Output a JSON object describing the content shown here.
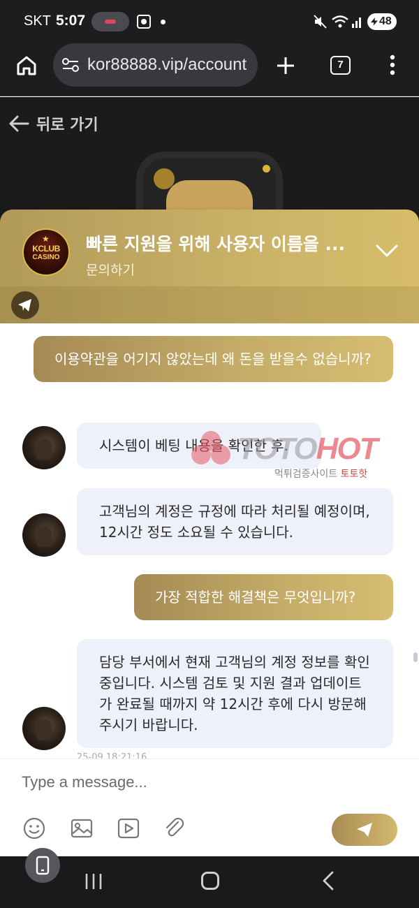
{
  "status_bar": {
    "carrier": "SKT",
    "time": "5:07",
    "battery": "48",
    "icons": [
      "screen-record-icon",
      "dot-icon",
      "mute-icon",
      "wifi-icon",
      "signal-icon",
      "battery-icon"
    ]
  },
  "browser": {
    "url": "kor88888.vip/account",
    "tab_count": "7",
    "icons": [
      "home-icon",
      "site-settings-icon",
      "plus-icon",
      "tabs-icon",
      "more-icon"
    ]
  },
  "page": {
    "back_label": "뒤로 가기"
  },
  "chat": {
    "title": "빠른 지원을 위해 사용자 이름을 ...",
    "subtitle": "문의하기",
    "logo": {
      "top": "KCLUB",
      "bottom": "CASINO"
    },
    "messages": [
      {
        "from": "user",
        "text": "이용약관을 어기지 않았는데 왜 돈을 받을수 없습니까?"
      },
      {
        "from": "agent",
        "text": "시스템이 베팅 내용을 확인한 후."
      },
      {
        "from": "agent",
        "text": "고객님의 계정은 규정에 따라 처리될 예정이며, 12시간 정도 소요될 수 있습니다."
      },
      {
        "from": "user",
        "text": "가장 적합한 해결책은 무엇입니까?"
      },
      {
        "from": "agent",
        "text": "담당 부서에서 현재 고객님의 계정 정보를 확인 중입니다. 시스템 검토 및 지원 결과 업데이트가 완료될 때까지 약 12시간 후에 다시 방문해 주시기 바랍니다."
      }
    ],
    "partial_timestamp": "25-09 18:21:16"
  },
  "watermark": {
    "brand_a": "TOTO",
    "brand_b": "HOT",
    "sub_a": "먹튀검증사이트 ",
    "sub_b": "토토핫"
  },
  "composer": {
    "placeholder": "Type a message...",
    "tools": [
      "emoji-icon",
      "image-icon",
      "video-icon",
      "attach-icon"
    ]
  },
  "colors": {
    "gold_start": "#a68a55",
    "gold_end": "#d6bd72",
    "agent_bubble": "#eef0fa",
    "dark_bg": "#1d1d20"
  }
}
